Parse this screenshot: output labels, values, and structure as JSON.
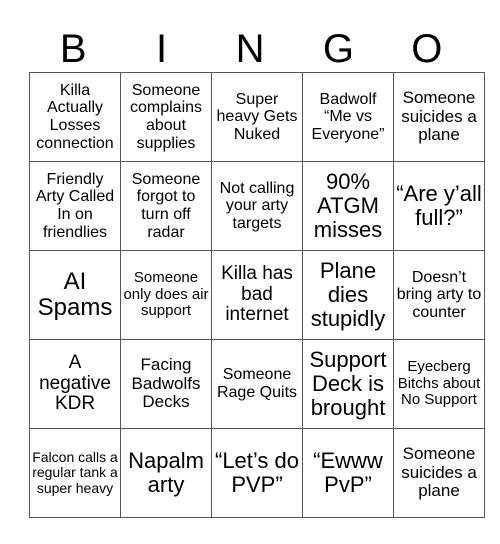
{
  "header": [
    "B",
    "I",
    "N",
    "G",
    "O"
  ],
  "rows": [
    [
      "Killa Actually Losses connection",
      "Someone complains about supplies",
      "Super heavy Gets Nuked",
      "Badwolf “Me vs Everyone”",
      "Someone suicides a plane"
    ],
    [
      "Friendly Arty Called In on friendlies",
      "Someone forgot to turn off radar",
      "Not calling your arty targets",
      "90% ATGM misses",
      "“Are y’all full?”"
    ],
    [
      "AI Spams",
      "Someone only does air support",
      "Killa has bad internet",
      "Plane dies stupidly",
      "Doesn’t bring arty to counter"
    ],
    [
      "A negative KDR",
      "Facing Badwolfs Decks",
      "Someone Rage Quits",
      "Support Deck is brought",
      "Eyecberg Bitchs about No Support"
    ],
    [
      "Falcon calls a regular tank a super heavy",
      "Napalm arty",
      "“Let’s do PVP”",
      "“Ewww PvP”",
      "Someone suicides a plane"
    ]
  ]
}
